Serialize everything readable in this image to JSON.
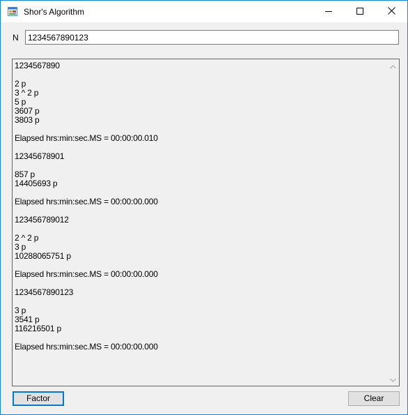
{
  "window": {
    "title": "Shor's Algorithm",
    "app_icon": "windows-form-icon",
    "controls": {
      "minimize": "minimize-icon",
      "maximize": "maximize-icon",
      "close": "close-icon"
    }
  },
  "input": {
    "label": "N",
    "value": "1234567890123"
  },
  "output": {
    "text": "1234567890\n\n2 p\n3 ^ 2 p\n5 p\n3607 p\n3803 p\n\nElapsed hrs:min:sec.MS = 00:00:00.010\n\n12345678901\n\n857 p\n14405693 p\n\nElapsed hrs:min:sec.MS = 00:00:00.000\n\n123456789012\n\n2 ^ 2 p\n3 p\n10288065751 p\n\nElapsed hrs:min:sec.MS = 00:00:00.000\n\n1234567890123\n\n3 p\n3541 p\n116216501 p\n\nElapsed hrs:min:sec.MS = 00:00:00.000",
    "scroll_up_icon": "scroll-up-arrow-icon",
    "scroll_down_icon": "scroll-down-arrow-icon"
  },
  "buttons": {
    "factor_label": "Factor",
    "clear_label": "Clear"
  },
  "colors": {
    "window_border": "#1883d7",
    "focus_accent": "#0078d7",
    "form_background": "#f0f0f0"
  }
}
